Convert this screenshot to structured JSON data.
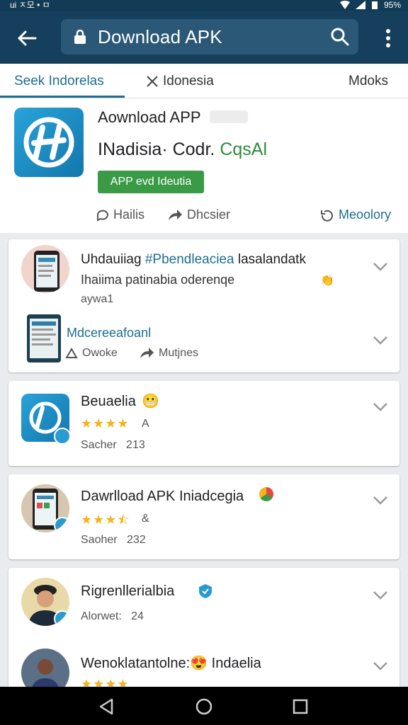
{
  "status": {
    "left": "ui ㅈ모 • ㅁ",
    "right": "95%"
  },
  "appbar": {
    "search_text": "Download APK"
  },
  "tabs": [
    "Seek Indorelas",
    "Idonesia",
    "Mdoks"
  ],
  "hero": {
    "title": "Aownload APP",
    "subtitle_dark": "INadisia· Codr.",
    "subtitle_green": "CqsAl",
    "button": "APP evd Ideutia",
    "actions": [
      "Hailis",
      "Dhcsier",
      "Meoolory"
    ]
  },
  "cards": [
    {
      "title_plain": "Uhdauiiag ",
      "title_blue": "#Pbendleaciea",
      "title_rest": " lasalandatk",
      "line2": "Ihaiima patinabia oderenqe",
      "line3": "aywa1",
      "sub_title": "Mdcereeafoanl",
      "sub_actions": [
        "Owoke",
        "Mutjnes"
      ]
    },
    {
      "title": "Beuaelia",
      "rating_text": "A",
      "meta": "Sacher",
      "count": "213",
      "stars": 4
    },
    {
      "title": "Dawrlload APK Iniadcegia",
      "rating_text": "&",
      "meta": "Saoher",
      "count": "232",
      "stars": 3.5
    },
    {
      "title": "Rigrenllerialbia",
      "meta": "Alorwet:",
      "count": "24"
    },
    {
      "title_plain": "Wenoklatantolne:",
      "title_rest": " Indaelia"
    }
  ],
  "colors": {
    "appbar": "#153f5d",
    "accent": "#1d6e8f",
    "green": "#3a9a46",
    "star": "#f2b51f"
  }
}
